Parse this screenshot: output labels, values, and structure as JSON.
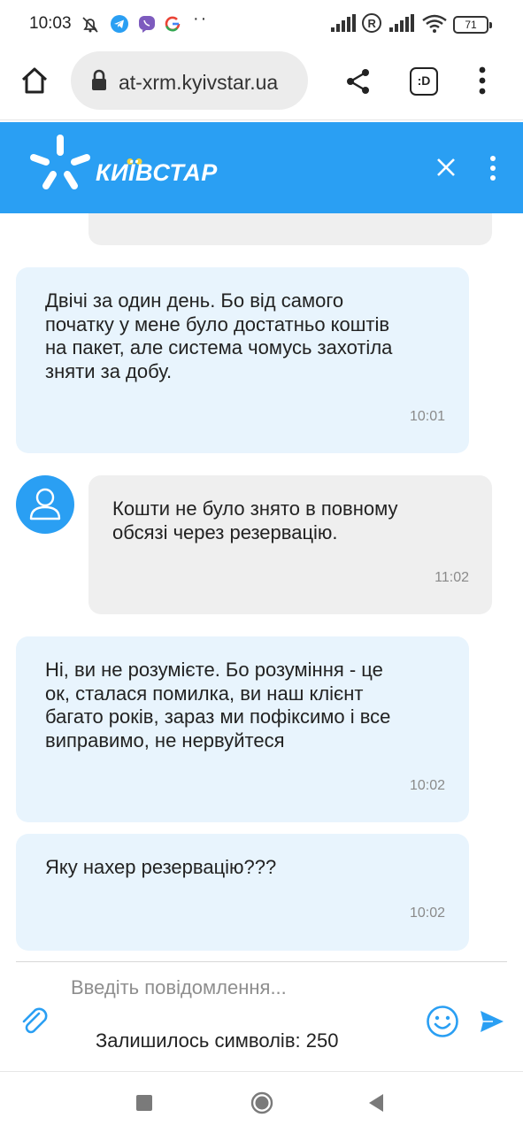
{
  "status_bar": {
    "time": "10:03",
    "battery": "71",
    "icons": [
      "muted-bell-icon",
      "telegram-icon",
      "viber-icon",
      "google-icon",
      "more-dots-icon",
      "signal-icon",
      "roaming-icon",
      "signal-icon",
      "wifi-icon",
      "battery-icon"
    ],
    "dots": "··"
  },
  "browser": {
    "url": "at-xrm.kyivstar.ua",
    "tab_count": ":D",
    "icons": [
      "home-icon",
      "lock-icon",
      "share-icon",
      "tabs-icon",
      "menu-icon"
    ]
  },
  "app_header": {
    "brand": "КИЇВСТАР",
    "color": "#2a9ff3",
    "icons": [
      "kyivstar-logo-icon",
      "close-icon",
      "kebab-menu-icon"
    ]
  },
  "messages": [
    {
      "id": 1,
      "sender": "user",
      "text_lines": [
        "Двічі за один день. Бо від самого",
        "початку у мене було достатньо коштів",
        "на пакет, але система чомусь захотіла",
        "зняти за добу."
      ],
      "time": "10:01"
    },
    {
      "id": 2,
      "sender": "agent",
      "text_lines": [
        "Кошти не було знято в повному",
        "обсязі через резервацію."
      ],
      "time": "11:02"
    },
    {
      "id": 3,
      "sender": "user",
      "text_lines": [
        "Ні, ви не розумієте. Бо розуміння - це",
        "ок, сталася помилка, ви наш клієнт",
        "багато років, зараз ми пофіксимо і все",
        "виправимо, не нервуйтеся"
      ],
      "time": "10:02"
    },
    {
      "id": 4,
      "sender": "user",
      "text_lines": [
        "Яку нахер резервацію???"
      ],
      "time": "10:02"
    }
  ],
  "input": {
    "placeholder": "Введіть повідомлення...",
    "value": "",
    "counter_label": "Залишилось символів: 250",
    "icons": [
      "attach-icon",
      "emoji-icon",
      "send-icon"
    ]
  },
  "nav_bar": {
    "icons": [
      "recents-icon",
      "home-icon",
      "back-icon"
    ]
  },
  "colors": {
    "accent": "#2a9ff3",
    "user_bubble": "#e8f4fd",
    "agent_bubble": "#efefef",
    "logo_dots": "#f5d33a"
  }
}
